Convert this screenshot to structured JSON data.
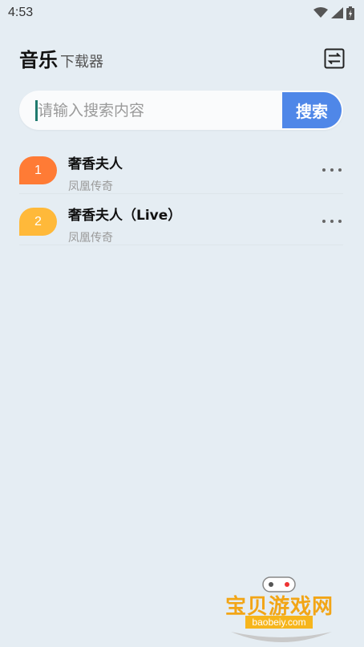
{
  "status_bar": {
    "time": "4:53"
  },
  "header": {
    "title": "音乐",
    "subtitle": "下载器",
    "icon": "swap-icon"
  },
  "search": {
    "placeholder": "请输入搜索内容",
    "value": "",
    "button_label": "搜索"
  },
  "songs": [
    {
      "rank": "1",
      "title": "奢香夫人",
      "artist": "凤凰传奇",
      "badge_color": "#ff7b35"
    },
    {
      "rank": "2",
      "title": "奢香夫人（Live）",
      "artist": "凤凰传奇",
      "badge_color": "#ffb93a"
    }
  ],
  "watermark": {
    "text": "宝贝游戏网",
    "url": "baobeiy.com"
  },
  "colors": {
    "accent": "#4f87e8",
    "background": "#e5edf3"
  }
}
